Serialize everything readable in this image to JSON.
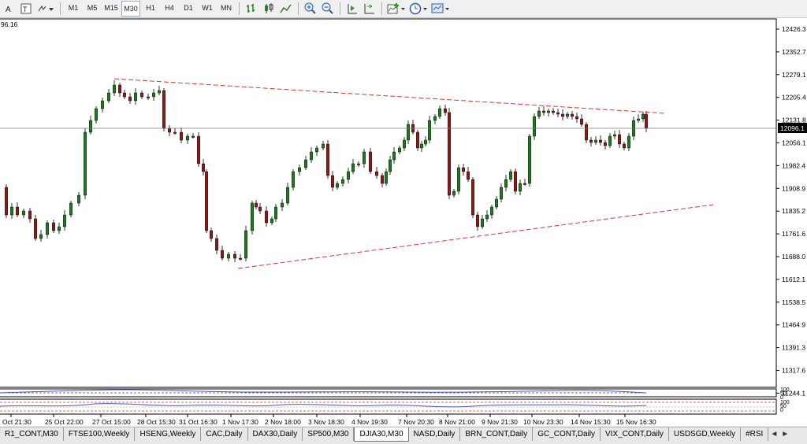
{
  "toolbar": {
    "timeframes": [
      "M1",
      "M5",
      "M15",
      "M30",
      "H1",
      "H4",
      "D1",
      "W1",
      "MN"
    ],
    "active_timeframe": "M30",
    "left_icons": [
      "text-tool-icon",
      "text-label-icon",
      "arrows-tool-icon"
    ],
    "right_icons": [
      "bar-chart-icon",
      "candlestick-chart-icon",
      "line-chart-icon",
      "zoom-in-icon",
      "zoom-out-icon",
      "chart-shift-icon",
      "autoscroll-icon",
      "indicators-icon",
      "periods-icon",
      "templates-icon"
    ]
  },
  "chart": {
    "corner_label": "96.16",
    "current_price": "12096.1",
    "price_labels": [
      "12426.3",
      "12352.7",
      "12279.1",
      "12205.4",
      "12131.8",
      "12056.1",
      "11982.4",
      "11908.9",
      "11835.2",
      "11761.6",
      "11688.0",
      "11612.1",
      "11538.5",
      "11464.9",
      "11391.3",
      "11317.6",
      "11244.1"
    ],
    "time_labels": [
      "Oct 21:30",
      "25 Oct 22:00",
      "27 Oct 15:00",
      "28 Oct 15:30",
      "31 Oct 16:30",
      "1 Nov 17:30",
      "2 Nov 18:00",
      "3 Nov 18:30",
      "4 Nov 19:30",
      "7 Nov 20:30",
      "8 Nov 21:00",
      "9 Nov 21:30",
      "10 Nov 23:30",
      "14 Nov 15:30",
      "15 Nov 16:30"
    ],
    "indicator1_labels": [
      "100",
      "50",
      "0"
    ],
    "indicator2_labels": [
      "100",
      "50",
      "0"
    ],
    "colors": {
      "bull": "#1d7a1d",
      "bear": "#8b1a1a",
      "trendline": "#e83030",
      "grid": "#000000",
      "indicator": "#5050d0"
    }
  },
  "tabs": {
    "items": [
      "R1_CONT,M30",
      "FTSE100,Weekly",
      "HSENG,Weekly",
      "CAC,Daily",
      "DAX30,Daily",
      "SP500,M30",
      "DJIA30,M30",
      "NASD,Daily",
      "BRN_CONT,Daily",
      "GC_CONT,Daily",
      "VIX_CONT,Daily",
      "USDSGD,Weekly",
      "#RSI"
    ],
    "active": "DJIA30,M30"
  }
}
